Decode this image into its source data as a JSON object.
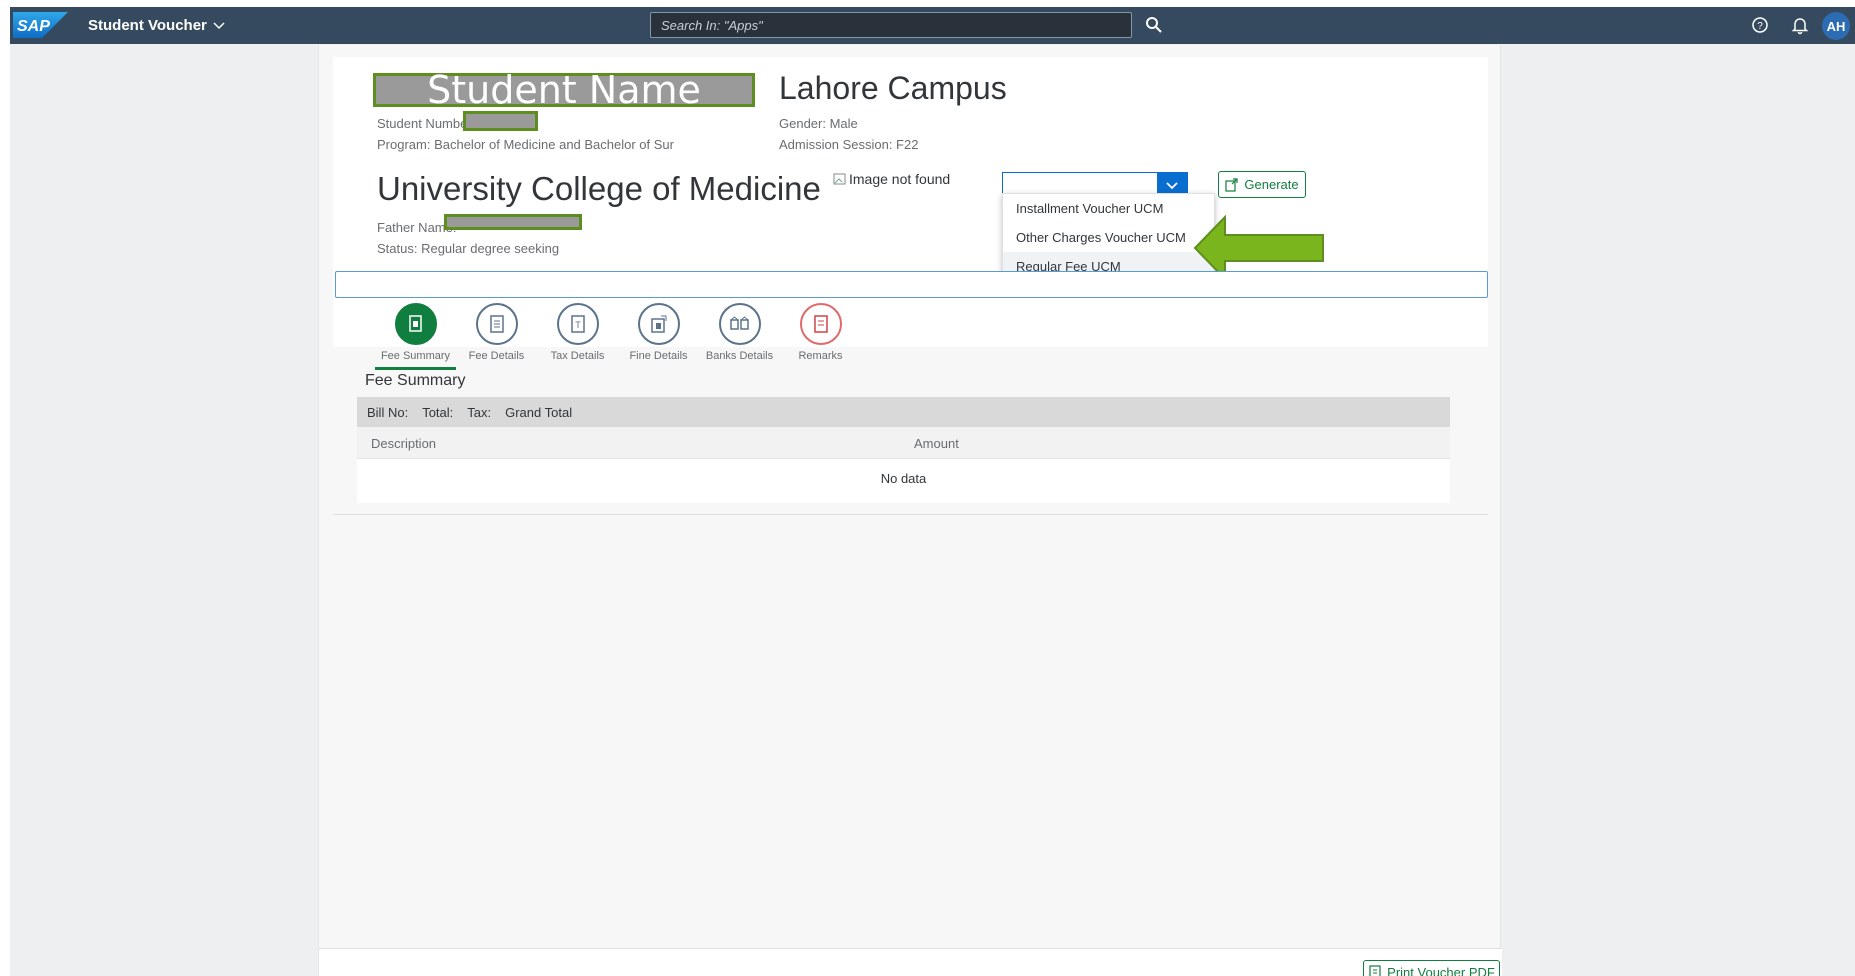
{
  "shell": {
    "logo": "SAP",
    "app_title": "Student Voucher",
    "search_placeholder": "Search In: \"Apps\"",
    "avatar_initials": "AH"
  },
  "student": {
    "name": "Student Name",
    "campus": "Lahore Campus",
    "number_label": "Student Number:",
    "program": "Program: Bachelor of Medicine and Bachelor of Sur",
    "gender": "Gender: Male",
    "admission": "Admission Session: F22",
    "college": "University College of Medicine",
    "father_label": "Father Name:",
    "status": "Status: Regular degree seeking",
    "image_alt": "Image not found"
  },
  "voucher": {
    "options": [
      "Installment Voucher UCM",
      "Other Charges Voucher UCM",
      "Regular Fee UCM"
    ],
    "generate_label": "Generate"
  },
  "tabs": [
    {
      "label": "Fee Summary",
      "icon": "fee-summary-icon"
    },
    {
      "label": "Fee Details",
      "icon": "fee-details-icon"
    },
    {
      "label": "Tax Details",
      "icon": "tax-details-icon"
    },
    {
      "label": "Fine Details",
      "icon": "fine-details-icon"
    },
    {
      "label": "Banks Details",
      "icon": "banks-details-icon"
    },
    {
      "label": "Remarks",
      "icon": "remarks-icon"
    }
  ],
  "fee_summary": {
    "title": "Fee Summary",
    "bill_no": "Bill No:",
    "total": "Total:",
    "tax": "Tax:",
    "grand_total": "Grand Total",
    "col_description": "Description",
    "col_amount": "Amount",
    "empty": "No data"
  },
  "footer": {
    "print_label": "Print Voucher PDF"
  },
  "colors": {
    "shell": "#354a5f",
    "accent_green": "#107e3e",
    "annotation_arrow": "#7ab51d",
    "select_blue": "#0a6ed1"
  }
}
